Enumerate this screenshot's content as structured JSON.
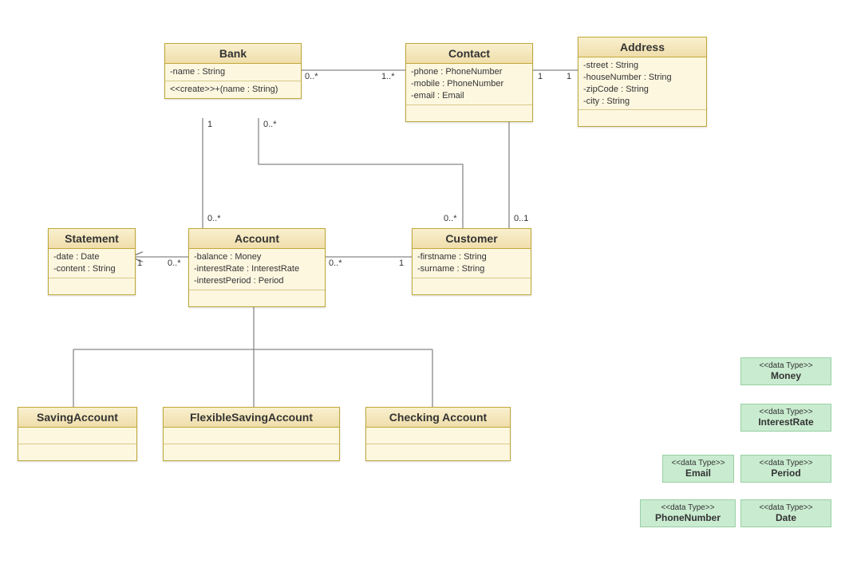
{
  "classes": {
    "bank": {
      "name": "Bank",
      "attrs": [
        "-name : String"
      ],
      "ops": [
        "<<create>>+(name : String)"
      ]
    },
    "contact": {
      "name": "Contact",
      "attrs": [
        "-phone : PhoneNumber",
        "-mobile : PhoneNumber",
        "-email : Email"
      ]
    },
    "address": {
      "name": "Address",
      "attrs": [
        "-street : String",
        "-houseNumber : String",
        "-zipCode : String",
        "-city : String"
      ]
    },
    "statement": {
      "name": "Statement",
      "attrs": [
        "-date : Date",
        "-content : String"
      ]
    },
    "account": {
      "name": "Account",
      "attrs": [
        "-balance : Money",
        "-interestRate : InterestRate",
        "-interestPeriod : Period"
      ]
    },
    "customer": {
      "name": "Customer",
      "attrs": [
        "-firstname : String",
        "-surname : String"
      ]
    },
    "saving": {
      "name": "SavingAccount"
    },
    "flexible": {
      "name": "FlexibleSavingAccount"
    },
    "checking": {
      "name": "Checking Account"
    }
  },
  "datatypes": {
    "money": {
      "stereo": "<<data Type>>",
      "name": "Money"
    },
    "interest": {
      "stereo": "<<data Type>>",
      "name": "InterestRate"
    },
    "period": {
      "stereo": "<<data Type>>",
      "name": "Period"
    },
    "email": {
      "stereo": "<<data Type>>",
      "name": "Email"
    },
    "phone": {
      "stereo": "<<data Type>>",
      "name": "PhoneNumber"
    },
    "date": {
      "stereo": "<<data Type>>",
      "name": "Date"
    }
  },
  "mult": {
    "bank_contact_left": "0..*",
    "bank_contact_right": "1..*",
    "contact_address_left": "1",
    "contact_address_right": "1",
    "bank_account_top": "1",
    "bank_account_bottom": "0..*",
    "bank_customer_top": "0..*",
    "bank_customer_bottom": "0..*",
    "contact_customer_bottom": "0..1",
    "statement_account_left": "1",
    "statement_account_right": "0..*",
    "account_customer_left": "0..*",
    "account_customer_right": "1"
  }
}
